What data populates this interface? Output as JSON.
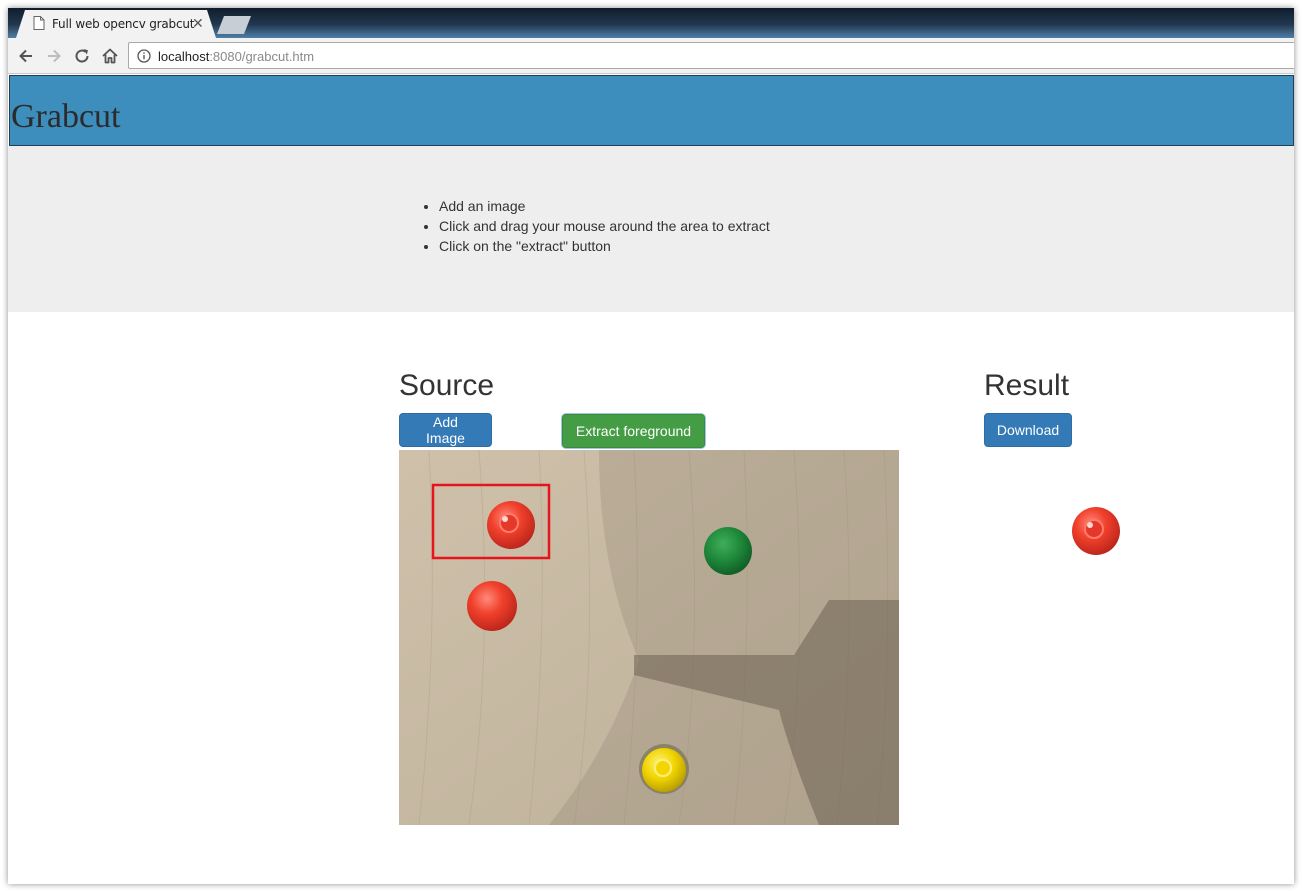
{
  "browser": {
    "tab_title": "Full web opencv grabcut",
    "tab_close_glyph": "✕",
    "url_host": "localhost",
    "url_path": ":8080/grabcut.htm",
    "icons": [
      "page-icon",
      "back-arrow-icon",
      "forward-arrow-icon",
      "reload-icon",
      "home-icon",
      "info-icon"
    ]
  },
  "header": {
    "title": "Grabcut",
    "background_color": "#3d8dbd"
  },
  "instructions": {
    "items": [
      "Add an image",
      "Click and drag your mouse around the area to extract",
      "Click on the \"extract\" button"
    ]
  },
  "source": {
    "heading": "Source",
    "add_image_label": "Add Image",
    "extract_label": "Extract foreground",
    "selection_color": "#e8141c"
  },
  "result": {
    "heading": "Result",
    "download_label": "Download"
  },
  "colors": {
    "primary": "#337ab7",
    "success": "#449d44",
    "instructions_bg": "#eeeeee"
  }
}
